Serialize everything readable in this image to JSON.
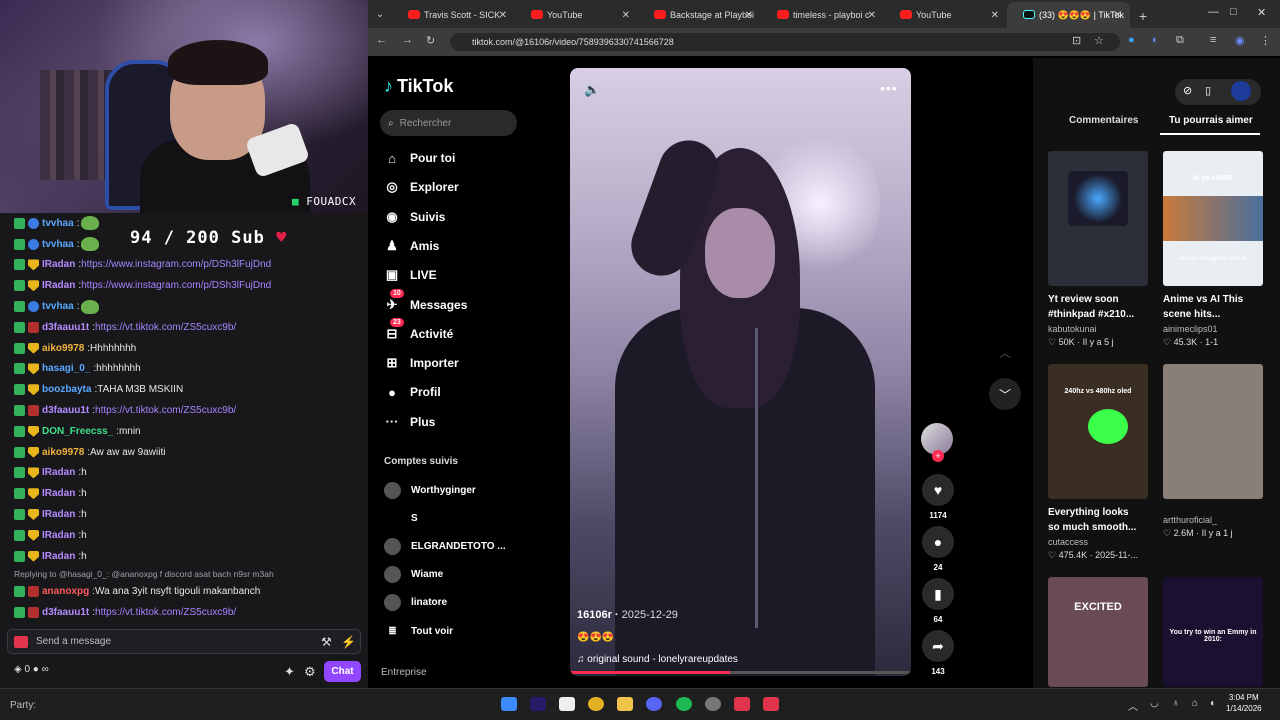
{
  "stream": {
    "cam_tag": "FOUADCX",
    "sub_goal": "94 / 200 Sub",
    "chat_messages": [
      {
        "user": "tvvhaa",
        "color": "#5aa8ff",
        "text": "",
        "emote": true
      },
      {
        "user": "tvvhaa",
        "color": "#5aa8ff",
        "text": "",
        "emote": true
      },
      {
        "user": "IRadan",
        "color": "#b48cff",
        "text": "https://www.instagram.com/p/DSh3lFujDnd",
        "link": true
      },
      {
        "user": "IRadan",
        "color": "#b48cff",
        "text": "https://www.instagram.com/p/DSh3lFujDnd",
        "link": true
      },
      {
        "user": "tvvhaa",
        "color": "#5aa8ff",
        "text": "",
        "emote": true
      },
      {
        "user": "d3faauu1t",
        "color": "#b48cff",
        "text": "https://vt.tiktok.com/ZS5cuxc9b/",
        "link": true
      },
      {
        "user": "aiko9978",
        "color": "#f0b43c",
        "text": "Hhhhhhhh"
      },
      {
        "user": "hasagi_0_",
        "color": "#5aa8ff",
        "text": "hhhhhhhh"
      },
      {
        "user": "boozbayta",
        "color": "#5aa8ff",
        "text": "TAHA M3B MSKIIN"
      },
      {
        "user": "d3faauu1t",
        "color": "#b48cff",
        "text": "https://vt.tiktok.com/ZS5cuxc9b/",
        "link": true
      },
      {
        "user": "DON_Freecss_",
        "color": "#3fe08a",
        "text": "mnin"
      },
      {
        "user": "aiko9978",
        "color": "#f0b43c",
        "text": "Aw aw aw 9awiiti"
      },
      {
        "user": "IRadan",
        "color": "#b48cff",
        "text": "h"
      },
      {
        "user": "IRadan",
        "color": "#b48cff",
        "text": "h"
      },
      {
        "user": "IRadan",
        "color": "#b48cff",
        "text": "h"
      },
      {
        "user": "IRadan",
        "color": "#b48cff",
        "text": "h"
      },
      {
        "user": "IRadan",
        "color": "#b48cff",
        "text": "h"
      }
    ],
    "reply_to": "Replying to @hasagi_0_: @ananoxpg f discord asat bach n9sr m3ah",
    "reply_msg": {
      "user": "ananoxpg",
      "color": "#ff5a5a",
      "text": "Wa ana 3yit nsyft tigouli makanbanch"
    },
    "last_msg": {
      "user": "d3faauu1t",
      "color": "#b48cff",
      "text": "https://vt.tiktok.com/ZS5cuxc9b/"
    },
    "send_placeholder": "Send a message",
    "points": "0",
    "chat_button": "Chat"
  },
  "browser": {
    "tabs": [
      {
        "title": "Travis Scott - SICK",
        "active": false
      },
      {
        "title": "YouTube",
        "active": false
      },
      {
        "title": "Backstage at Playboi",
        "active": false
      },
      {
        "title": "timeless - playboi c",
        "active": false
      },
      {
        "title": "YouTube",
        "active": false
      },
      {
        "title": "(33) 😍😍😍 | TikTok",
        "active": true
      }
    ],
    "url": "tiktok.com/@16106r/video/7589396330741566728"
  },
  "tiktok": {
    "logo": "TikTok",
    "search_placeholder": "Rechercher",
    "nav": [
      {
        "label": "Pour toi",
        "icon": "home-icon"
      },
      {
        "label": "Explorer",
        "icon": "compass-icon"
      },
      {
        "label": "Suivis",
        "icon": "following-icon"
      },
      {
        "label": "Amis",
        "icon": "friends-icon"
      },
      {
        "label": "LIVE",
        "icon": "live-icon"
      },
      {
        "label": "Messages",
        "icon": "messages-icon",
        "badge": "10"
      },
      {
        "label": "Activité",
        "icon": "activity-icon",
        "badge": "23"
      },
      {
        "label": "Importer",
        "icon": "upload-icon"
      },
      {
        "label": "Profil",
        "icon": "profile-icon"
      },
      {
        "label": "Plus",
        "icon": "more-icon"
      }
    ],
    "following_header": "Comptes suivis",
    "following": [
      "Worthyginger",
      "S",
      "ELGRANDETOTO ...",
      "Wiame",
      "linatore"
    ],
    "see_all": "Tout voir",
    "footer": "Entreprise",
    "video": {
      "author": "16106r",
      "date": "2025-12-29",
      "caption": "😍😍😍",
      "sound": "original sound - lonelyrareupdates",
      "progress": 0.47
    },
    "actions": {
      "likes": "1174",
      "comments": "24",
      "saves": "64",
      "shares": "143"
    },
    "right_tabs": [
      "Commentaires",
      "Tu pourrais aimer"
    ],
    "suggestions": [
      {
        "title": "Yt review soon\n#thinkpad #x210...",
        "author": "kabutokunai",
        "stats": "♡ 50K · Il y a 5 j",
        "thumb": "#2c2f38"
      },
      {
        "title": "Anime vs AI This\nscene hits...",
        "author": "ainimeclips01",
        "stats": "♡ 45.3K · 1-1",
        "thumb": "#e9eef2",
        "overlay_top": "AI vs ANIME",
        "overlay_bottom": "Anime reimagined with AI"
      },
      {
        "title": "Everything looks\nso much smooth...",
        "author": "cutaccess",
        "stats": "♡ 475.4K · 2025-11-...",
        "thumb": "#3a2d22",
        "overlay_top": "240hz vs 480hz oled"
      },
      {
        "title": "",
        "author": "artthuroficial_",
        "stats": "♡ 2.6M · Il y a 1 j",
        "thumb": "#8a7f78"
      },
      {
        "title": "",
        "author": "",
        "stats": "",
        "thumb": "#6a4a55",
        "overlay_top": "EXCITED"
      },
      {
        "title": "",
        "author": "",
        "stats": "",
        "thumb": "#1a1030",
        "overlay_top": "You try to win an Emmy in 2010:"
      }
    ]
  },
  "taskbar": {
    "party": "Party:",
    "time": "3:04 PM",
    "date": "1/14/2026"
  }
}
